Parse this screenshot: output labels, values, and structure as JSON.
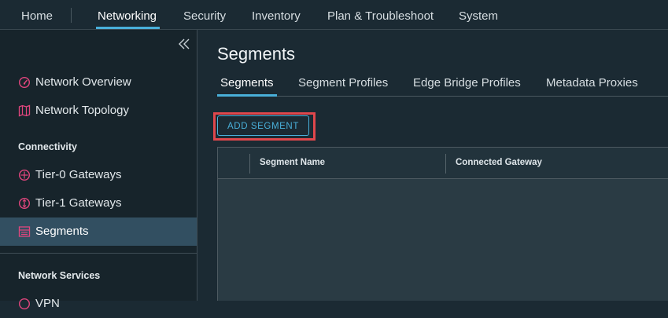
{
  "topnav": {
    "items": [
      {
        "label": "Home"
      },
      {
        "label": "Networking"
      },
      {
        "label": "Security"
      },
      {
        "label": "Inventory"
      },
      {
        "label": "Plan & Troubleshoot"
      },
      {
        "label": "System"
      }
    ],
    "active": "Networking"
  },
  "sidebar": {
    "collapse_icon": "double-chevron-left-icon",
    "top_items": [
      {
        "label": "Network Overview",
        "icon": "gauge-icon"
      },
      {
        "label": "Network Topology",
        "icon": "topology-map-icon"
      }
    ],
    "sections": [
      {
        "heading": "Connectivity",
        "items": [
          {
            "label": "Tier-0 Gateways",
            "icon": "gateway-icon"
          },
          {
            "label": "Tier-1 Gateways",
            "icon": "gateway-icon"
          },
          {
            "label": "Segments",
            "icon": "segments-icon",
            "active": true
          }
        ]
      },
      {
        "heading": "Network Services",
        "items": [
          {
            "label": "VPN",
            "icon": "gateway-icon"
          }
        ]
      }
    ]
  },
  "main": {
    "title": "Segments",
    "tabs": [
      {
        "label": "Segments"
      },
      {
        "label": "Segment Profiles"
      },
      {
        "label": "Edge Bridge Profiles"
      },
      {
        "label": "Metadata Proxies"
      }
    ],
    "active_tab": "Segments",
    "add_button_label": "ADD SEGMENT",
    "grid": {
      "columns": [
        "",
        "Segment Name",
        "Connected Gateway"
      ],
      "rows": []
    }
  },
  "colors": {
    "accent": "#49afd9",
    "highlight": "#e0474c",
    "icon": "#e2467e",
    "background": "#1b2a33",
    "sidebar_active": "#324f61"
  }
}
